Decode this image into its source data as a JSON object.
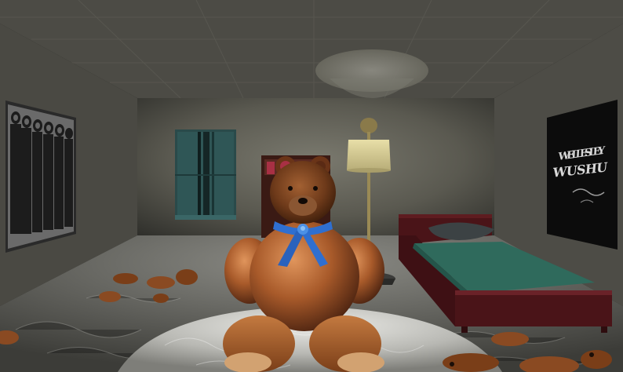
{
  "scene": {
    "type": "3d-rendered-bedroom",
    "right_poster": {
      "line1": "WELLESLEY",
      "line2": "WUSHU"
    },
    "objects": [
      "ceiling-light",
      "left-band-poster",
      "window",
      "floor-lamp",
      "bookshelf",
      "bed",
      "rug",
      "teddy-bear",
      "scattered-toy-bears"
    ],
    "colors": {
      "wall": "#6f6e63",
      "ceiling": "#4f4e47",
      "window_glass": "#2e5454",
      "bed_frame": "#4a1418",
      "bed_sheet": "#2f6a5c",
      "bear_fur": "#8a4a22",
      "bear_scarf": "#2f6fd0",
      "rug": "#c9c9c4",
      "floor": "#55554f"
    }
  }
}
